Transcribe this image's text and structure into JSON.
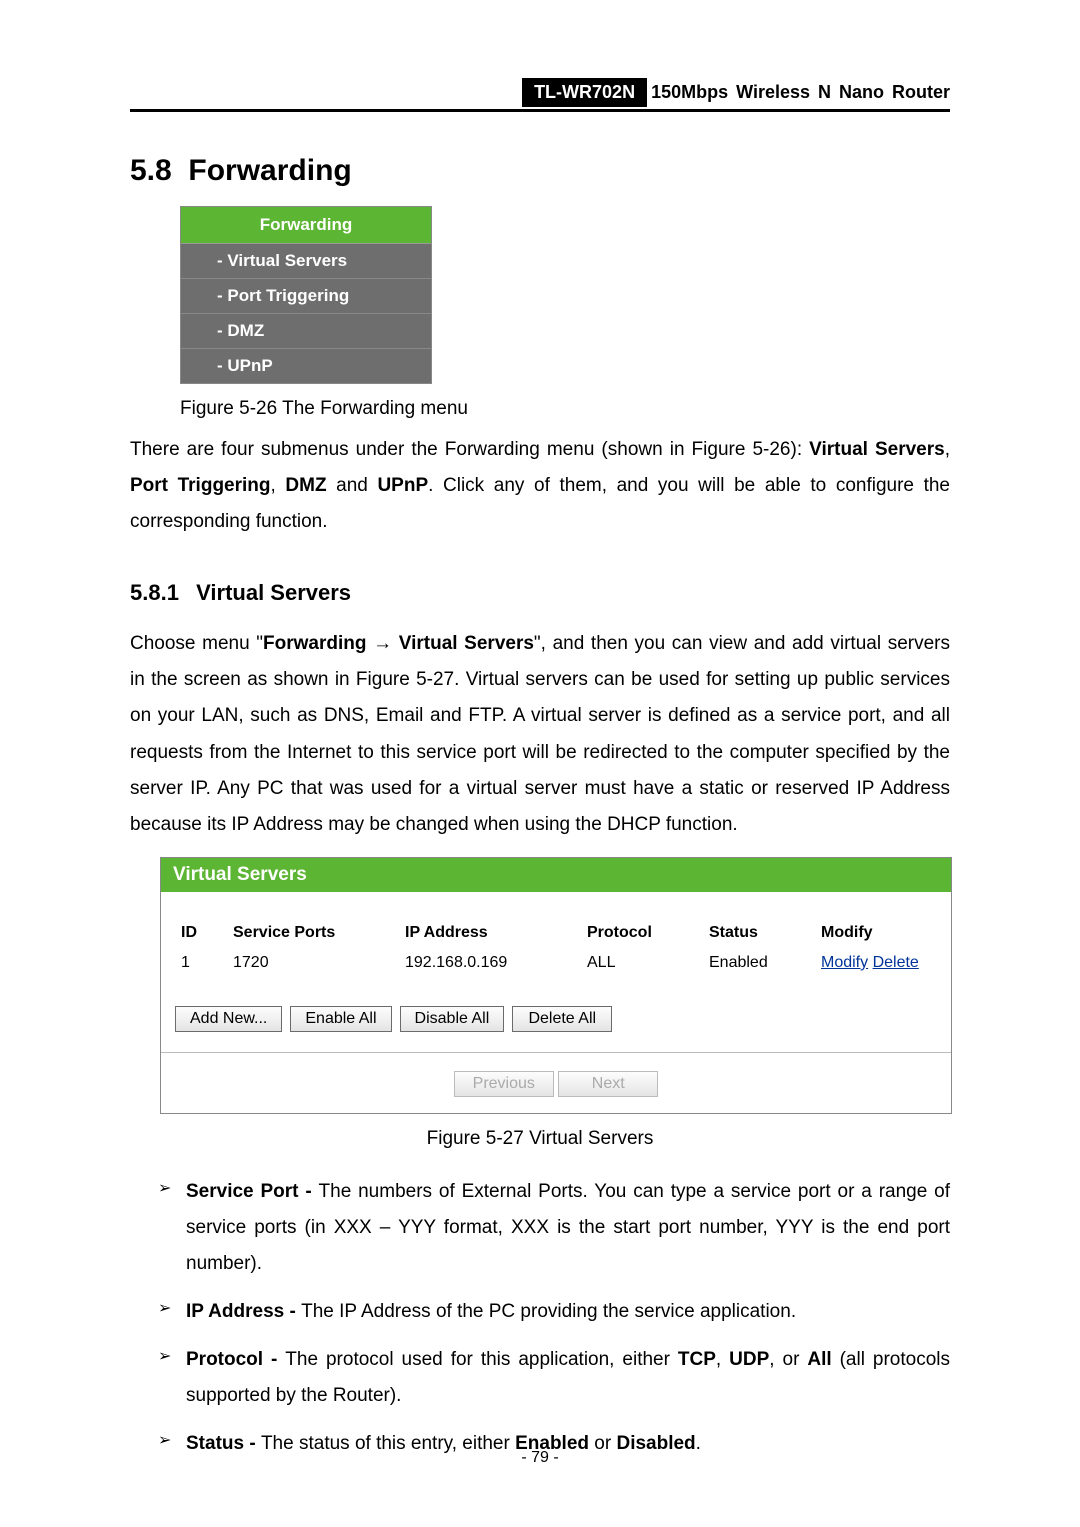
{
  "header": {
    "model": "TL-WR702N",
    "product": "150Mbps Wireless N Nano Router"
  },
  "section": {
    "number": "5.8",
    "title": "Forwarding"
  },
  "menuBox": {
    "header": "Forwarding",
    "items": [
      "- Virtual Servers",
      "- Port Triggering",
      "- DMZ",
      "- UPnP"
    ]
  },
  "figCaption26": "Figure 5-26 The Forwarding menu",
  "intro": {
    "pre": "There are four submenus under the Forwarding menu (shown in Figure 5-26): ",
    "bold1": "Virtual Servers",
    "sep1": ", ",
    "bold2": "Port Triggering",
    "sep2": ", ",
    "bold3": "DMZ",
    "sep3": " and ",
    "bold4": "UPnP",
    "post": ". Click any of them, and you will be able to configure the corresponding function."
  },
  "subsection": {
    "number": "5.8.1",
    "title": "Virtual Servers"
  },
  "vsIntro": {
    "pre": "Choose menu \"",
    "b1": "Forwarding",
    "arrow": " → ",
    "b2": "Virtual Servers",
    "post": "\", and then you can view and add virtual servers in the screen as shown in Figure 5-27. Virtual servers can be used for setting up public services on your LAN, such as DNS, Email and FTP. A virtual server is defined as a service port, and all requests from the Internet to this service port will be redirected to the computer specified by the server IP. Any PC that was used for a virtual server must have a static or reserved IP Address because its IP Address may be changed when using the DHCP function."
  },
  "vsPanel": {
    "title": "Virtual Servers",
    "headers": [
      "ID",
      "Service Ports",
      "IP Address",
      "Protocol",
      "Status",
      "Modify"
    ],
    "row": {
      "id": "1",
      "ports": "1720",
      "ip": "192.168.0.169",
      "proto": "ALL",
      "status": "Enabled",
      "modify": "Modify",
      "delete": "Delete"
    },
    "btns": {
      "add": "Add New...",
      "enable": "Enable All",
      "disable": "Disable All",
      "delete": "Delete All"
    },
    "nav": {
      "prev": "Previous",
      "next": "Next"
    }
  },
  "figCaption27": "Figure 5-27   Virtual Servers",
  "bullets": {
    "sp": {
      "b": "Service Port - ",
      "t": "The numbers of External Ports. You can type a service port or a range of service ports (in XXX – YYY format, XXX is the start port number, YYY is the end port number)."
    },
    "ip": {
      "b": "IP Address - ",
      "t": "The IP Address of the PC providing the service application."
    },
    "pr": {
      "pre": "Protocol - ",
      "t1": "The protocol used for this application, either ",
      "b1": "TCP",
      "s1": ", ",
      "b2": "UDP",
      "s2": ", or ",
      "b3": "All",
      "t2": " (all protocols supported by the Router)."
    },
    "st": {
      "pre": "Status - ",
      "t1": "The status of this entry, either ",
      "b1": "Enabled",
      "s1": " or ",
      "b2": "Disabled",
      "t2": "."
    }
  },
  "pageNumber": "- 79 -"
}
